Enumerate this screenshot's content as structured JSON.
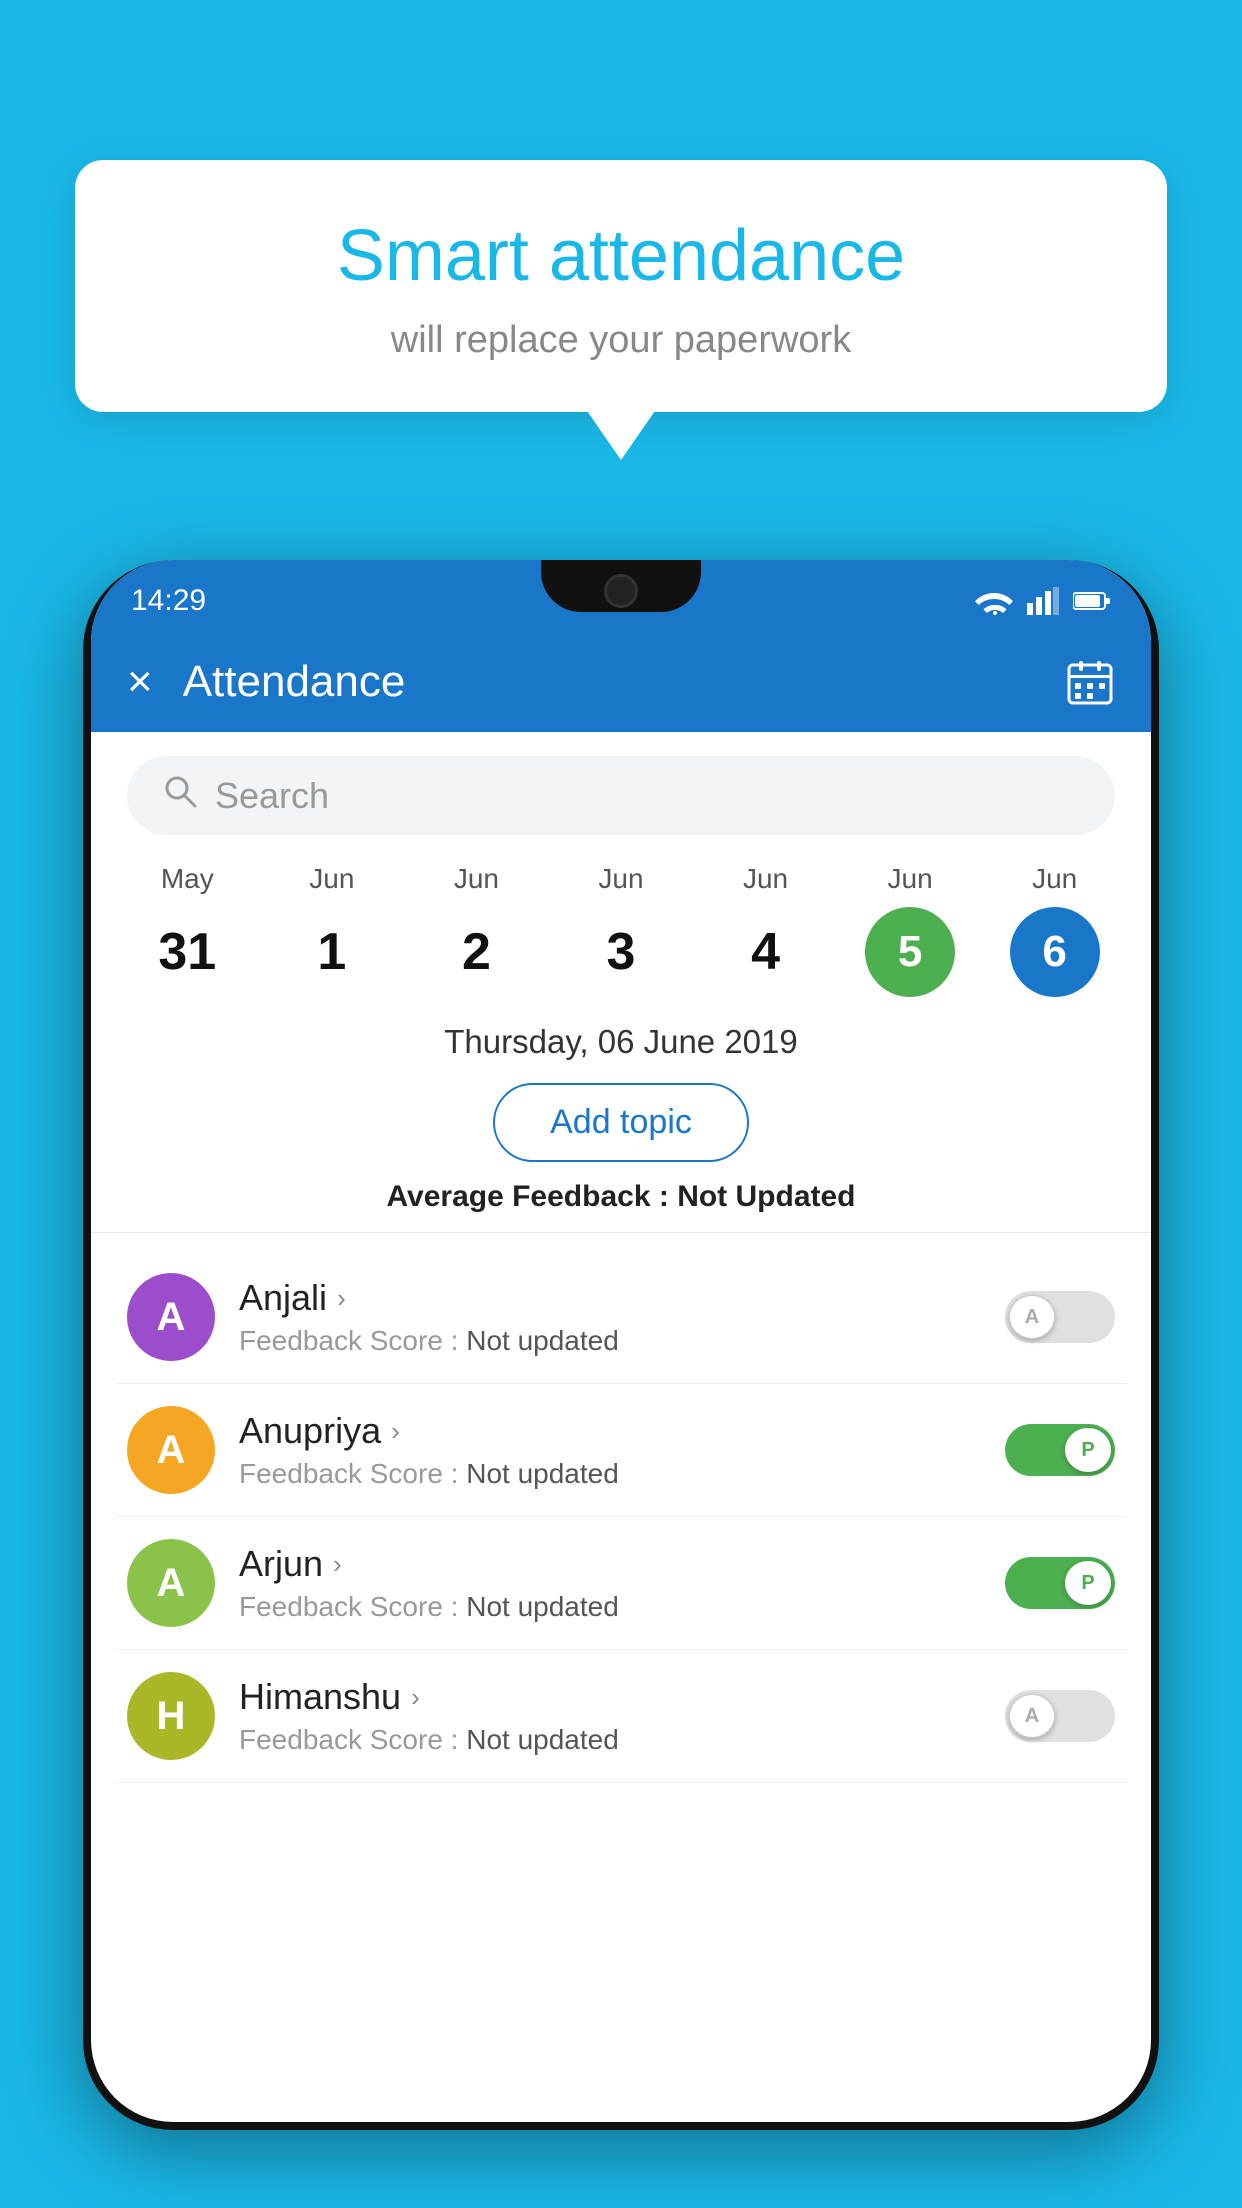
{
  "background_color": "#1ab8e8",
  "bubble": {
    "title": "Smart attendance",
    "subtitle": "will replace your paperwork"
  },
  "status_bar": {
    "time": "14:29"
  },
  "header": {
    "title": "Attendance",
    "close_label": "×",
    "calendar_icon": "calendar"
  },
  "search": {
    "placeholder": "Search"
  },
  "calendar": {
    "days": [
      {
        "month": "May",
        "day": "31",
        "style": "normal"
      },
      {
        "month": "Jun",
        "day": "1",
        "style": "normal"
      },
      {
        "month": "Jun",
        "day": "2",
        "style": "normal"
      },
      {
        "month": "Jun",
        "day": "3",
        "style": "normal"
      },
      {
        "month": "Jun",
        "day": "4",
        "style": "normal"
      },
      {
        "month": "Jun",
        "day": "5",
        "style": "today"
      },
      {
        "month": "Jun",
        "day": "6",
        "style": "selected"
      }
    ]
  },
  "selected_date": "Thursday, 06 June 2019",
  "add_topic_label": "Add topic",
  "avg_feedback_label": "Average Feedback :",
  "avg_feedback_value": "Not Updated",
  "students": [
    {
      "name": "Anjali",
      "avatar_letter": "A",
      "avatar_color": "#9c4dcc",
      "feedback_label": "Feedback Score :",
      "feedback_value": "Not updated",
      "toggle": "off",
      "toggle_letter": "A"
    },
    {
      "name": "Anupriya",
      "avatar_letter": "A",
      "avatar_color": "#f5a623",
      "feedback_label": "Feedback Score :",
      "feedback_value": "Not updated",
      "toggle": "on",
      "toggle_letter": "P"
    },
    {
      "name": "Arjun",
      "avatar_letter": "A",
      "avatar_color": "#8bc34a",
      "feedback_label": "Feedback Score :",
      "feedback_value": "Not updated",
      "toggle": "on",
      "toggle_letter": "P"
    },
    {
      "name": "Himanshu",
      "avatar_letter": "H",
      "avatar_color": "#aab828",
      "feedback_label": "Feedback Score :",
      "feedback_value": "Not updated",
      "toggle": "off",
      "toggle_letter": "A"
    }
  ]
}
